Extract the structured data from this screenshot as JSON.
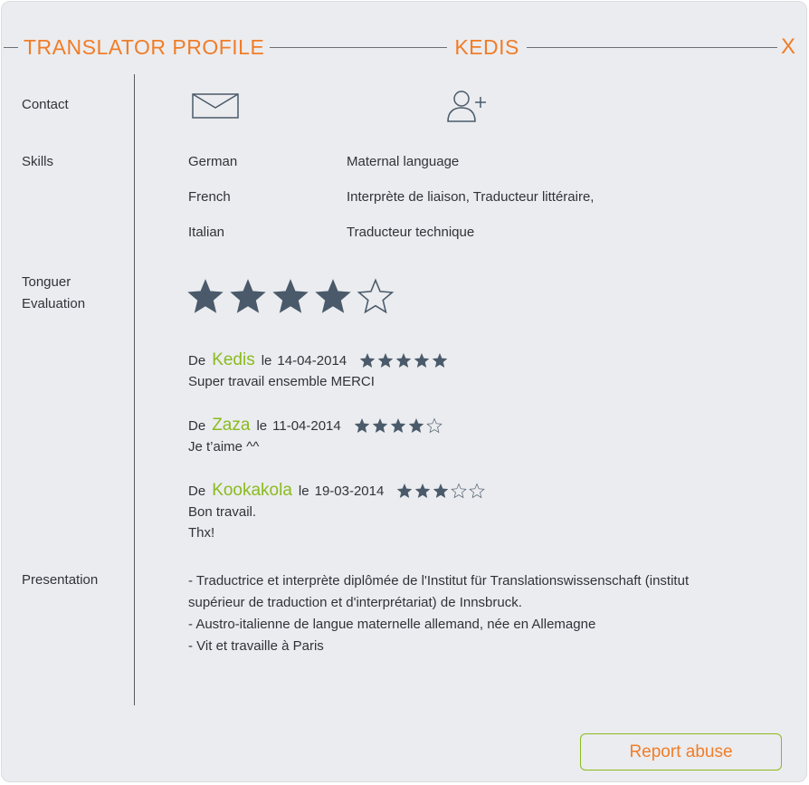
{
  "header": {
    "title": "TRANSLATOR PROFILE",
    "name": "KEDIS",
    "close_label": "X"
  },
  "labels": {
    "contact": "Contact",
    "skills": "Skills",
    "tongue_eval_1": "Tonguer",
    "tongue_eval_2": "Evaluation",
    "presentation": "Presentation"
  },
  "contact": {
    "icons": [
      "envelope-icon",
      "add-user-icon"
    ]
  },
  "skills": [
    {
      "language": "German",
      "detail": "Maternal language"
    },
    {
      "language": "French",
      "detail": "Interprète de liaison, Traducteur littéraire,"
    },
    {
      "language": "Italian",
      "detail": "Traducteur technique"
    }
  ],
  "evaluation": {
    "rating": 4,
    "max": 5
  },
  "reviews": [
    {
      "prefix": "De",
      "author": "Kedis",
      "le": "le",
      "date": "14-04-2014",
      "rating": 5,
      "comment": [
        "Super travail ensemble MERCI"
      ]
    },
    {
      "prefix": "De",
      "author": "Zaza",
      "le": "le",
      "date": "11-04-2014",
      "rating": 4,
      "comment": [
        "Je t’aime ^^"
      ]
    },
    {
      "prefix": "De",
      "author": "Kookakola",
      "le": "le",
      "date": "19-03-2014",
      "rating": 3,
      "comment": [
        "Bon travail.",
        "Thx!"
      ]
    }
  ],
  "presentation": {
    "lines": [
      "- Traductrice et interprète diplômée de l'Institut für Translationswissenschaft (institut",
      "supérieur de traduction et d'interprétariat) de Innsbruck.",
      "- Austro-italienne de langue maternelle allemand, née en Allemagne",
      "- Vit et travaille à Paris"
    ]
  },
  "actions": {
    "report_label": "Report abuse"
  },
  "colors": {
    "accent": "#f07d28",
    "author": "#8abb1e",
    "star": "#4a5a6a",
    "panel": "#ebecef"
  }
}
